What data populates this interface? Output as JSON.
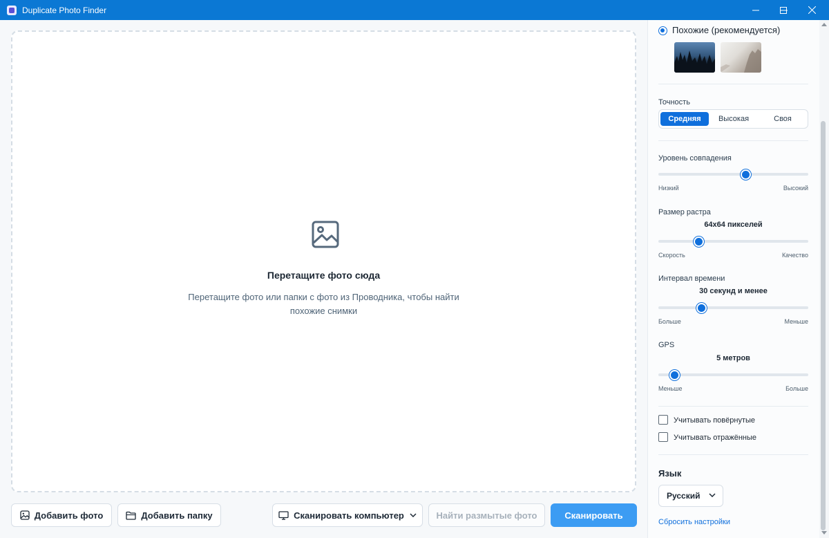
{
  "window": {
    "title": "Duplicate Photo Finder",
    "controls": [
      "minimize",
      "maximize",
      "close"
    ]
  },
  "dropzone": {
    "icon": "image-icon",
    "title": "Перетащите фото сюда",
    "subtitle_line1": "Перетащите фото или папки с фото из Проводника, чтобы найти",
    "subtitle_line2": "похожие снимки"
  },
  "buttons": {
    "add_photo": "Добавить фото",
    "add_folder": "Добавить папку",
    "scan_computer": "Сканировать компьютер",
    "find_blurry": "Найти размытые фото",
    "scan": "Сканировать"
  },
  "settings": {
    "mode_label": "Похожие (рекомендуется)",
    "accuracy": {
      "label": "Точность",
      "options": [
        "Средняя",
        "Высокая",
        "Своя"
      ],
      "selected": "Средняя"
    },
    "match_level": {
      "label": "Уровень совпадения",
      "min_label": "Низкий",
      "max_label": "Высокий",
      "value_fraction": 0.59
    },
    "raster_size": {
      "label": "Размер растра",
      "value": "64x64 пикселей",
      "min_label": "Скорость",
      "max_label": "Качество",
      "value_fraction": 0.25
    },
    "time_interval": {
      "label": "Интервал времени",
      "value": "30 секунд и менее",
      "min_label": "Больше",
      "max_label": "Меньше",
      "value_fraction": 0.27
    },
    "gps": {
      "label": "GPS",
      "value": "5 метров",
      "min_label": "Меньше",
      "max_label": "Больше",
      "value_fraction": 0.08
    },
    "consider_rotated": "Учитывать повёрнутые",
    "consider_mirrored": "Учитывать отражённые",
    "language": {
      "label": "Язык",
      "selected": "Русский"
    },
    "reset_link": "Сбросить настройки"
  },
  "colors": {
    "titlebar": "#0b78d4",
    "accent": "#0f6fdc",
    "primary_button": "#3c9cf3"
  }
}
